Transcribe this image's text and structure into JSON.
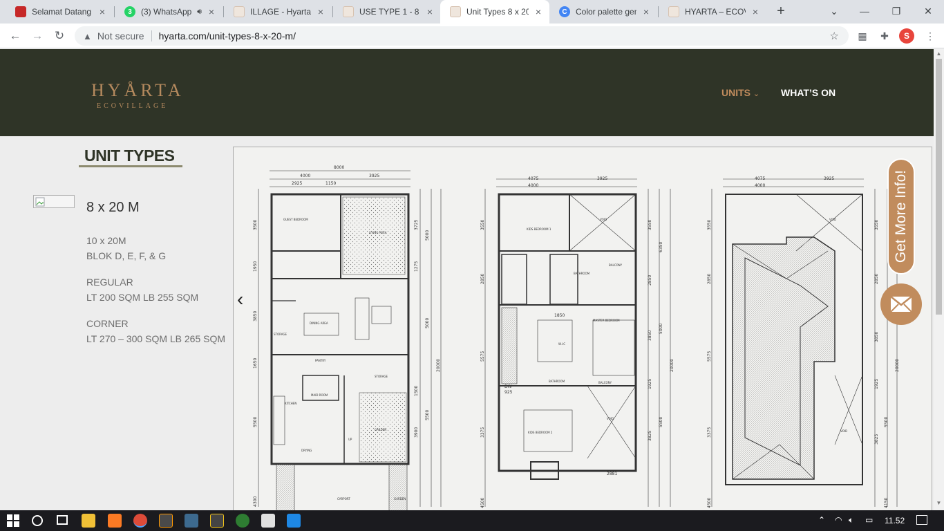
{
  "browser": {
    "tabs": [
      {
        "title": "Selamat Datang d",
        "favicon_color": "#c62828",
        "close": "×"
      },
      {
        "title": "(3) WhatsApp",
        "favicon_color": "#25d366",
        "close": "×",
        "badge": "3"
      },
      {
        "title": "ILLAGE - Hyarta E",
        "favicon_color": "#d7c2b0",
        "close": "×"
      },
      {
        "title": "USE TYPE 1 - 8 x 2",
        "favicon_color": "#d7c2b0",
        "close": "×"
      },
      {
        "title": "Unit Types 8 x 20",
        "favicon_color": "#d7c2b0",
        "close": "×",
        "active": true
      },
      {
        "title": "Color palette gen",
        "favicon_color": "#4285f4",
        "close": "×"
      },
      {
        "title": "HYARTA – ECOVIL",
        "favicon_color": "#d7c2b0",
        "close": "×"
      }
    ],
    "new_tab": "+",
    "security_label": "Not secure",
    "url": "hyarta.com/unit-types-8-x-20-m/",
    "profile_initial": "S"
  },
  "site": {
    "logo_main": "HYÅRTA",
    "logo_sub": "ECOVILLAGE",
    "nav": {
      "units": "UNITS",
      "units_caret": "⌄",
      "whats_on": "WHAT’S ON"
    },
    "accent_color": "#c18c5d",
    "header_color": "#2f3427"
  },
  "content": {
    "heading": "UNIT TYPES",
    "unit_name": "8 x 20 M",
    "info": [
      {
        "line1": "10 x 20M",
        "line2": "BLOK D, E, F, & G"
      },
      {
        "line1": "REGULAR",
        "line2": "LT 200 SQM LB 255 SQM"
      },
      {
        "line1": "CORNER",
        "line2": "LT 270 – 300 SQM LB 265 SQM"
      }
    ],
    "floating_button": "Get More Info!"
  },
  "floorplan": {
    "plan1": {
      "top_dims": [
        "8000",
        "4000",
        "3925",
        "2925",
        "1150"
      ],
      "right_dims": [
        "3725",
        "5000",
        "1275",
        "5000",
        "20000",
        "3900",
        "1500",
        "5500"
      ],
      "left_dims": [
        "3500",
        "1950",
        "3850",
        "1650",
        "5500",
        "4300"
      ],
      "rooms": [
        "GUEST BEDROOM",
        "LIVING AREA",
        "DINING AREA",
        "STORAGE",
        "PANTRY",
        "KITCHEN",
        "MAID ROOM",
        "STORAGE",
        "GARDEN",
        "DRYING",
        "CARPORT",
        "GARDEN",
        "UP"
      ]
    },
    "plan2": {
      "top_dims": [
        "4075",
        "4000",
        "3925"
      ],
      "right_dims": [
        "3550",
        "6350",
        "2850",
        "3850",
        "1925",
        "5000",
        "20000",
        "5500",
        "3825"
      ],
      "left_dims": [
        "3550",
        "2850",
        "5575",
        "3375",
        "4500"
      ],
      "rooms": [
        "KIDS BEDROOM 1",
        "VOID",
        "BATHROOM",
        "BALCONY",
        "MASTER BEDROOM",
        "W.I.C",
        "BATHROOM",
        "BALCONY",
        "VOID",
        "KIDS BEDROOM 2",
        "DW",
        "925",
        "1850",
        "2881"
      ]
    },
    "plan3": {
      "top_dims": [
        "4075",
        "4000",
        "3925"
      ],
      "right_dims": [
        "3550",
        "2850",
        "3850",
        "1925",
        "20000",
        "5500",
        "3825",
        "4150"
      ],
      "left_dims": [
        "3550",
        "2850",
        "5575",
        "3375",
        "4500"
      ],
      "rooms": [
        "VOID",
        "VOID"
      ]
    }
  },
  "taskbar": {
    "time": "11.52"
  }
}
